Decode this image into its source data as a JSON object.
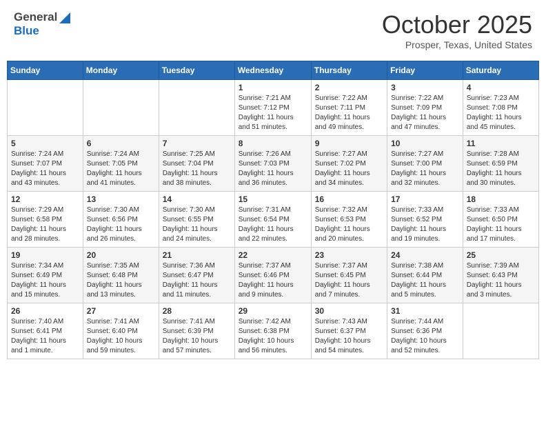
{
  "header": {
    "logo_general": "General",
    "logo_blue": "Blue",
    "month": "October 2025",
    "location": "Prosper, Texas, United States"
  },
  "calendar": {
    "days_of_week": [
      "Sunday",
      "Monday",
      "Tuesday",
      "Wednesday",
      "Thursday",
      "Friday",
      "Saturday"
    ],
    "weeks": [
      [
        {
          "day": "",
          "info": ""
        },
        {
          "day": "",
          "info": ""
        },
        {
          "day": "",
          "info": ""
        },
        {
          "day": "1",
          "info": "Sunrise: 7:21 AM\nSunset: 7:12 PM\nDaylight: 11 hours\nand 51 minutes."
        },
        {
          "day": "2",
          "info": "Sunrise: 7:22 AM\nSunset: 7:11 PM\nDaylight: 11 hours\nand 49 minutes."
        },
        {
          "day": "3",
          "info": "Sunrise: 7:22 AM\nSunset: 7:09 PM\nDaylight: 11 hours\nand 47 minutes."
        },
        {
          "day": "4",
          "info": "Sunrise: 7:23 AM\nSunset: 7:08 PM\nDaylight: 11 hours\nand 45 minutes."
        }
      ],
      [
        {
          "day": "5",
          "info": "Sunrise: 7:24 AM\nSunset: 7:07 PM\nDaylight: 11 hours\nand 43 minutes."
        },
        {
          "day": "6",
          "info": "Sunrise: 7:24 AM\nSunset: 7:05 PM\nDaylight: 11 hours\nand 41 minutes."
        },
        {
          "day": "7",
          "info": "Sunrise: 7:25 AM\nSunset: 7:04 PM\nDaylight: 11 hours\nand 38 minutes."
        },
        {
          "day": "8",
          "info": "Sunrise: 7:26 AM\nSunset: 7:03 PM\nDaylight: 11 hours\nand 36 minutes."
        },
        {
          "day": "9",
          "info": "Sunrise: 7:27 AM\nSunset: 7:02 PM\nDaylight: 11 hours\nand 34 minutes."
        },
        {
          "day": "10",
          "info": "Sunrise: 7:27 AM\nSunset: 7:00 PM\nDaylight: 11 hours\nand 32 minutes."
        },
        {
          "day": "11",
          "info": "Sunrise: 7:28 AM\nSunset: 6:59 PM\nDaylight: 11 hours\nand 30 minutes."
        }
      ],
      [
        {
          "day": "12",
          "info": "Sunrise: 7:29 AM\nSunset: 6:58 PM\nDaylight: 11 hours\nand 28 minutes."
        },
        {
          "day": "13",
          "info": "Sunrise: 7:30 AM\nSunset: 6:56 PM\nDaylight: 11 hours\nand 26 minutes."
        },
        {
          "day": "14",
          "info": "Sunrise: 7:30 AM\nSunset: 6:55 PM\nDaylight: 11 hours\nand 24 minutes."
        },
        {
          "day": "15",
          "info": "Sunrise: 7:31 AM\nSunset: 6:54 PM\nDaylight: 11 hours\nand 22 minutes."
        },
        {
          "day": "16",
          "info": "Sunrise: 7:32 AM\nSunset: 6:53 PM\nDaylight: 11 hours\nand 20 minutes."
        },
        {
          "day": "17",
          "info": "Sunrise: 7:33 AM\nSunset: 6:52 PM\nDaylight: 11 hours\nand 19 minutes."
        },
        {
          "day": "18",
          "info": "Sunrise: 7:33 AM\nSunset: 6:50 PM\nDaylight: 11 hours\nand 17 minutes."
        }
      ],
      [
        {
          "day": "19",
          "info": "Sunrise: 7:34 AM\nSunset: 6:49 PM\nDaylight: 11 hours\nand 15 minutes."
        },
        {
          "day": "20",
          "info": "Sunrise: 7:35 AM\nSunset: 6:48 PM\nDaylight: 11 hours\nand 13 minutes."
        },
        {
          "day": "21",
          "info": "Sunrise: 7:36 AM\nSunset: 6:47 PM\nDaylight: 11 hours\nand 11 minutes."
        },
        {
          "day": "22",
          "info": "Sunrise: 7:37 AM\nSunset: 6:46 PM\nDaylight: 11 hours\nand 9 minutes."
        },
        {
          "day": "23",
          "info": "Sunrise: 7:37 AM\nSunset: 6:45 PM\nDaylight: 11 hours\nand 7 minutes."
        },
        {
          "day": "24",
          "info": "Sunrise: 7:38 AM\nSunset: 6:44 PM\nDaylight: 11 hours\nand 5 minutes."
        },
        {
          "day": "25",
          "info": "Sunrise: 7:39 AM\nSunset: 6:43 PM\nDaylight: 11 hours\nand 3 minutes."
        }
      ],
      [
        {
          "day": "26",
          "info": "Sunrise: 7:40 AM\nSunset: 6:41 PM\nDaylight: 11 hours\nand 1 minute."
        },
        {
          "day": "27",
          "info": "Sunrise: 7:41 AM\nSunset: 6:40 PM\nDaylight: 10 hours\nand 59 minutes."
        },
        {
          "day": "28",
          "info": "Sunrise: 7:41 AM\nSunset: 6:39 PM\nDaylight: 10 hours\nand 57 minutes."
        },
        {
          "day": "29",
          "info": "Sunrise: 7:42 AM\nSunset: 6:38 PM\nDaylight: 10 hours\nand 56 minutes."
        },
        {
          "day": "30",
          "info": "Sunrise: 7:43 AM\nSunset: 6:37 PM\nDaylight: 10 hours\nand 54 minutes."
        },
        {
          "day": "31",
          "info": "Sunrise: 7:44 AM\nSunset: 6:36 PM\nDaylight: 10 hours\nand 52 minutes."
        },
        {
          "day": "",
          "info": ""
        }
      ]
    ]
  }
}
